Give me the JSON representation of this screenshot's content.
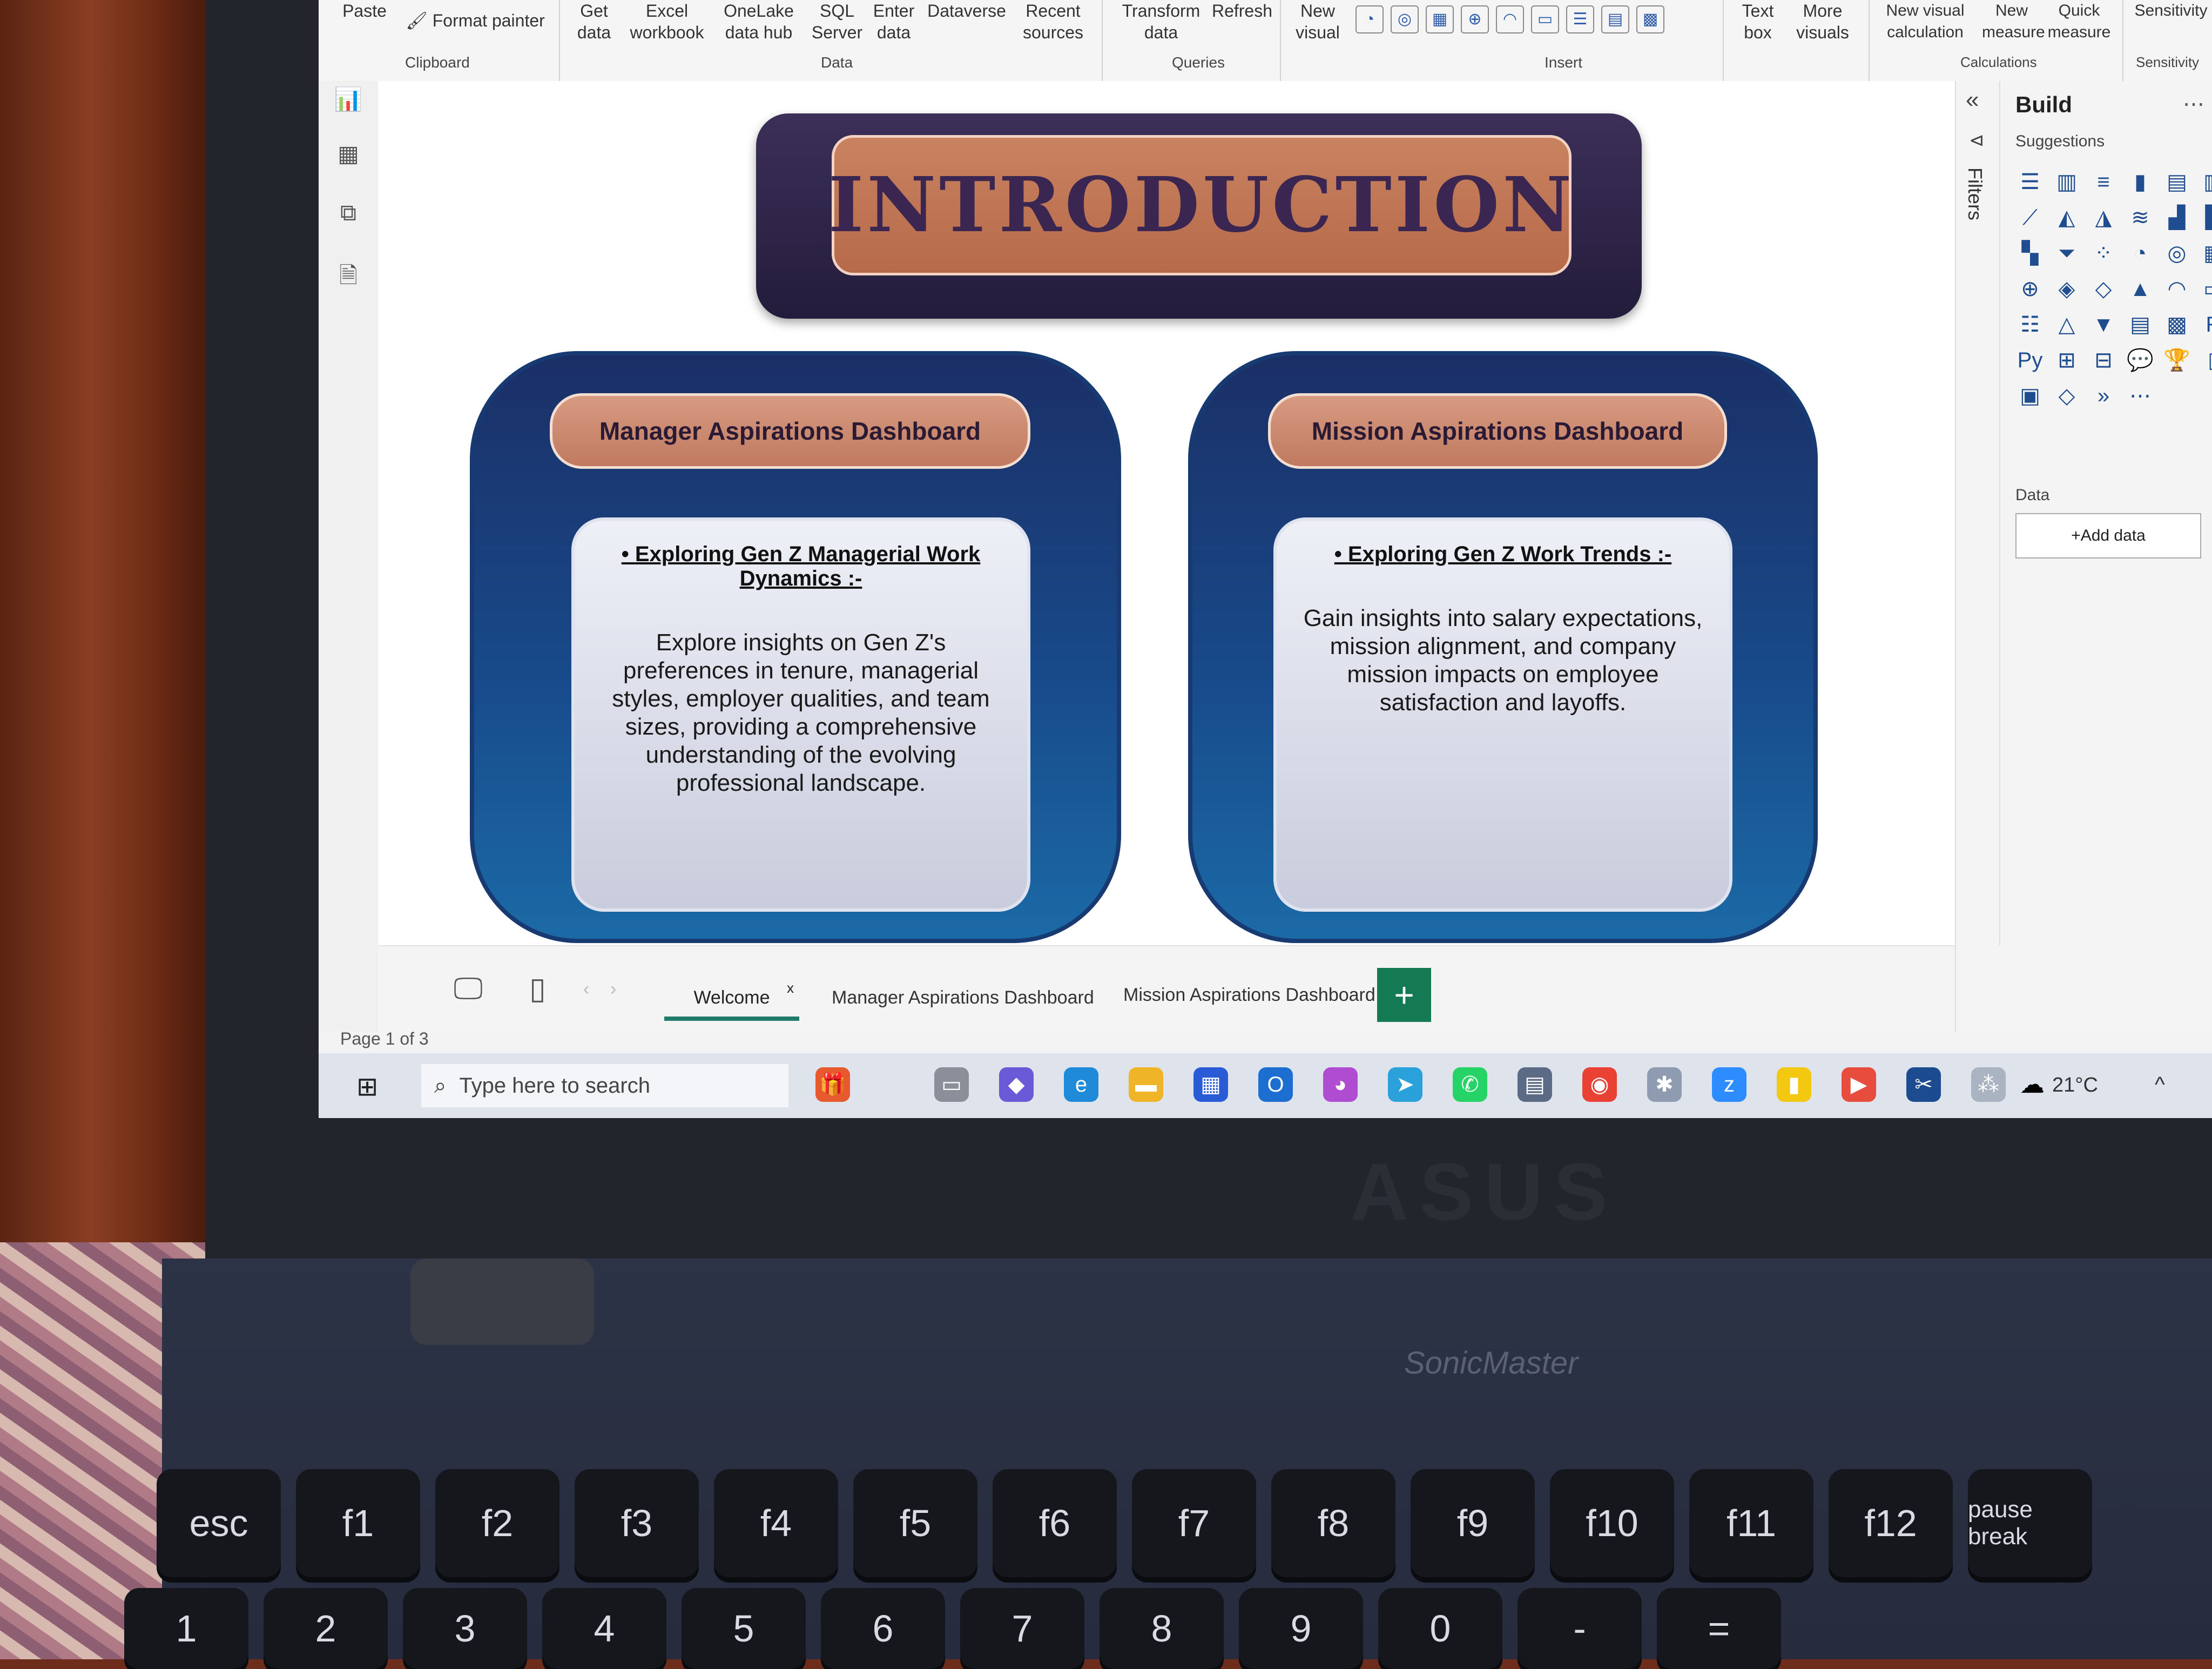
{
  "ribbon": {
    "paste": "Paste",
    "format_painter": "Format painter",
    "clipboard": "Clipboard",
    "get_data": "Get\ndata",
    "excel": "Excel\nworkbook",
    "onelake": "OneLake\ndata hub",
    "sql": "SQL\nServer",
    "enter_data": "Enter\ndata",
    "dataverse": "Dataverse",
    "recent": "Recent\nsources",
    "data_group": "Data",
    "transform": "Transform\ndata",
    "refresh": "Refresh",
    "queries": "Queries",
    "new_visual": "New\nvisual",
    "insert": "Insert",
    "text_box": "Text\nbox",
    "more_visuals": "More\nvisuals",
    "new_visual_calc": "New visual\ncalculation",
    "new_measure": "New\nmeasure",
    "quick_measure": "Quick\nmeasure",
    "calculations": "Calculations",
    "sensitivity": "Sensitivity",
    "sensitivity_group": "Sensitivity"
  },
  "intro": {
    "title": "INTRODUCTION"
  },
  "cards": [
    {
      "title": "Manager Aspirations Dashboard",
      "heading": "Exploring Gen Z Managerial Work Dynamics :-",
      "text": "Explore insights on Gen Z's preferences in tenure, managerial styles, employer qualities, and team sizes, providing a comprehensive understanding of the evolving professional landscape."
    },
    {
      "title": "Mission Aspirations Dashboard",
      "heading": "Exploring Gen Z  Work Trends :-",
      "text": "Gain insights into salary expectations, mission alignment, and company mission impacts on employee satisfaction and layoffs."
    }
  ],
  "build_panel": {
    "title": "Build",
    "suggestions": "Suggestions",
    "filters": "Filters",
    "data_label": "Data",
    "add_data": "+Add data"
  },
  "tabs": {
    "welcome": "Welcome",
    "manager": "Manager Aspirations Dashboard",
    "mission": "Mission Aspirations Dashboard",
    "add": "+"
  },
  "status": {
    "page": "Page 1 of 3"
  },
  "taskbar": {
    "search_placeholder": "Type here to search",
    "temperature": "21°C"
  },
  "laptop": {
    "brand": "ASUS",
    "model": "SonicMaster",
    "keys": [
      "esc",
      "f1",
      "f2",
      "f3",
      "f4",
      "f5",
      "f6",
      "f7",
      "f8",
      "f9",
      "f10",
      "f11",
      "f12",
      "pause break"
    ],
    "num_keys": [
      "1",
      "2",
      "3",
      "4",
      "5",
      "6",
      "7",
      "8",
      "9",
      "0",
      "-",
      "="
    ]
  }
}
